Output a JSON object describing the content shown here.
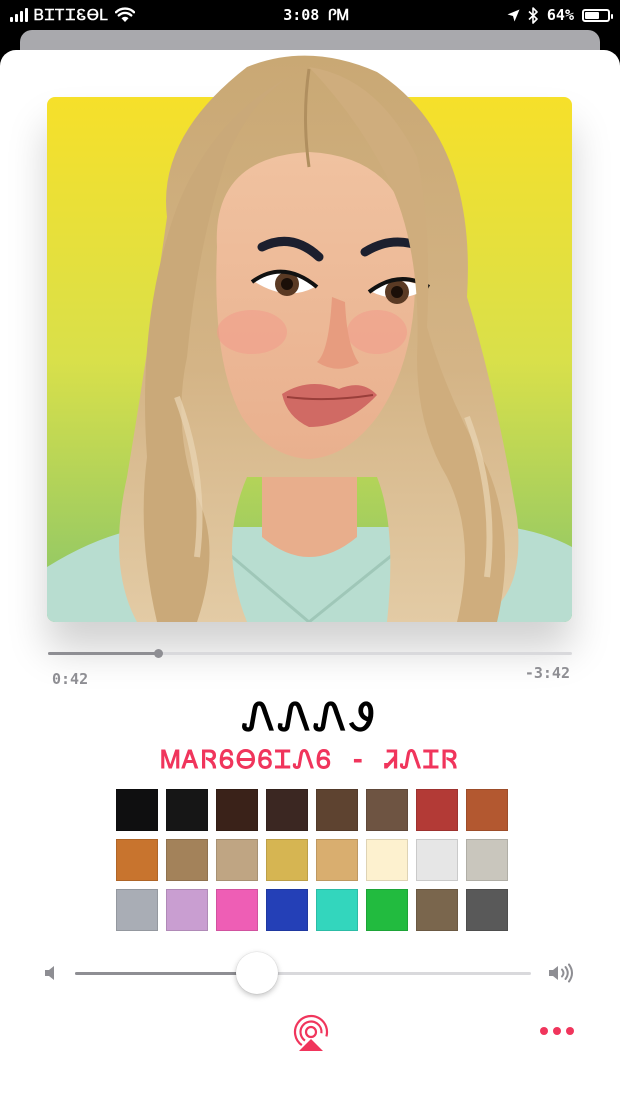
{
  "status_bar": {
    "carrier": "ᏴᏆᎢᏆᏋᎾᏞ",
    "time": "3:08 ᎵᎷ",
    "battery_percent": "64%",
    "battery_level": 0.64,
    "icons": [
      "signal-icon",
      "wifi-icon",
      "location-icon",
      "bluetooth-icon",
      "battery-icon"
    ]
  },
  "player": {
    "progress": {
      "elapsed": "0:42",
      "remaining": "-3:42",
      "fraction": 0.21
    },
    "title": "ᏁᏁᏁᏭ",
    "artist": "ᎷᎪᏒᏮᎾᏮᏆᏁᏮ - ᏘᏁᏆᏒ",
    "volume": 0.4,
    "accent_color": "#f0355c"
  },
  "swatches": {
    "colors": [
      "#0f0f10",
      "#161616",
      "#3a2219",
      "#3b2722",
      "#5e4330",
      "#6e5442",
      "#b33a36",
      "#b35830",
      "#c8742e",
      "#a3825a",
      "#bfa583",
      "#d6b552",
      "#d9ae6f",
      "#fdf1cf",
      "#e6e6e6",
      "#c9c6bd",
      "#a9adb5",
      "#c99ed1",
      "#ee5eb5",
      "#2440b7",
      "#33d6bd",
      "#22bb3f",
      "#7a664d",
      "#595959"
    ]
  }
}
